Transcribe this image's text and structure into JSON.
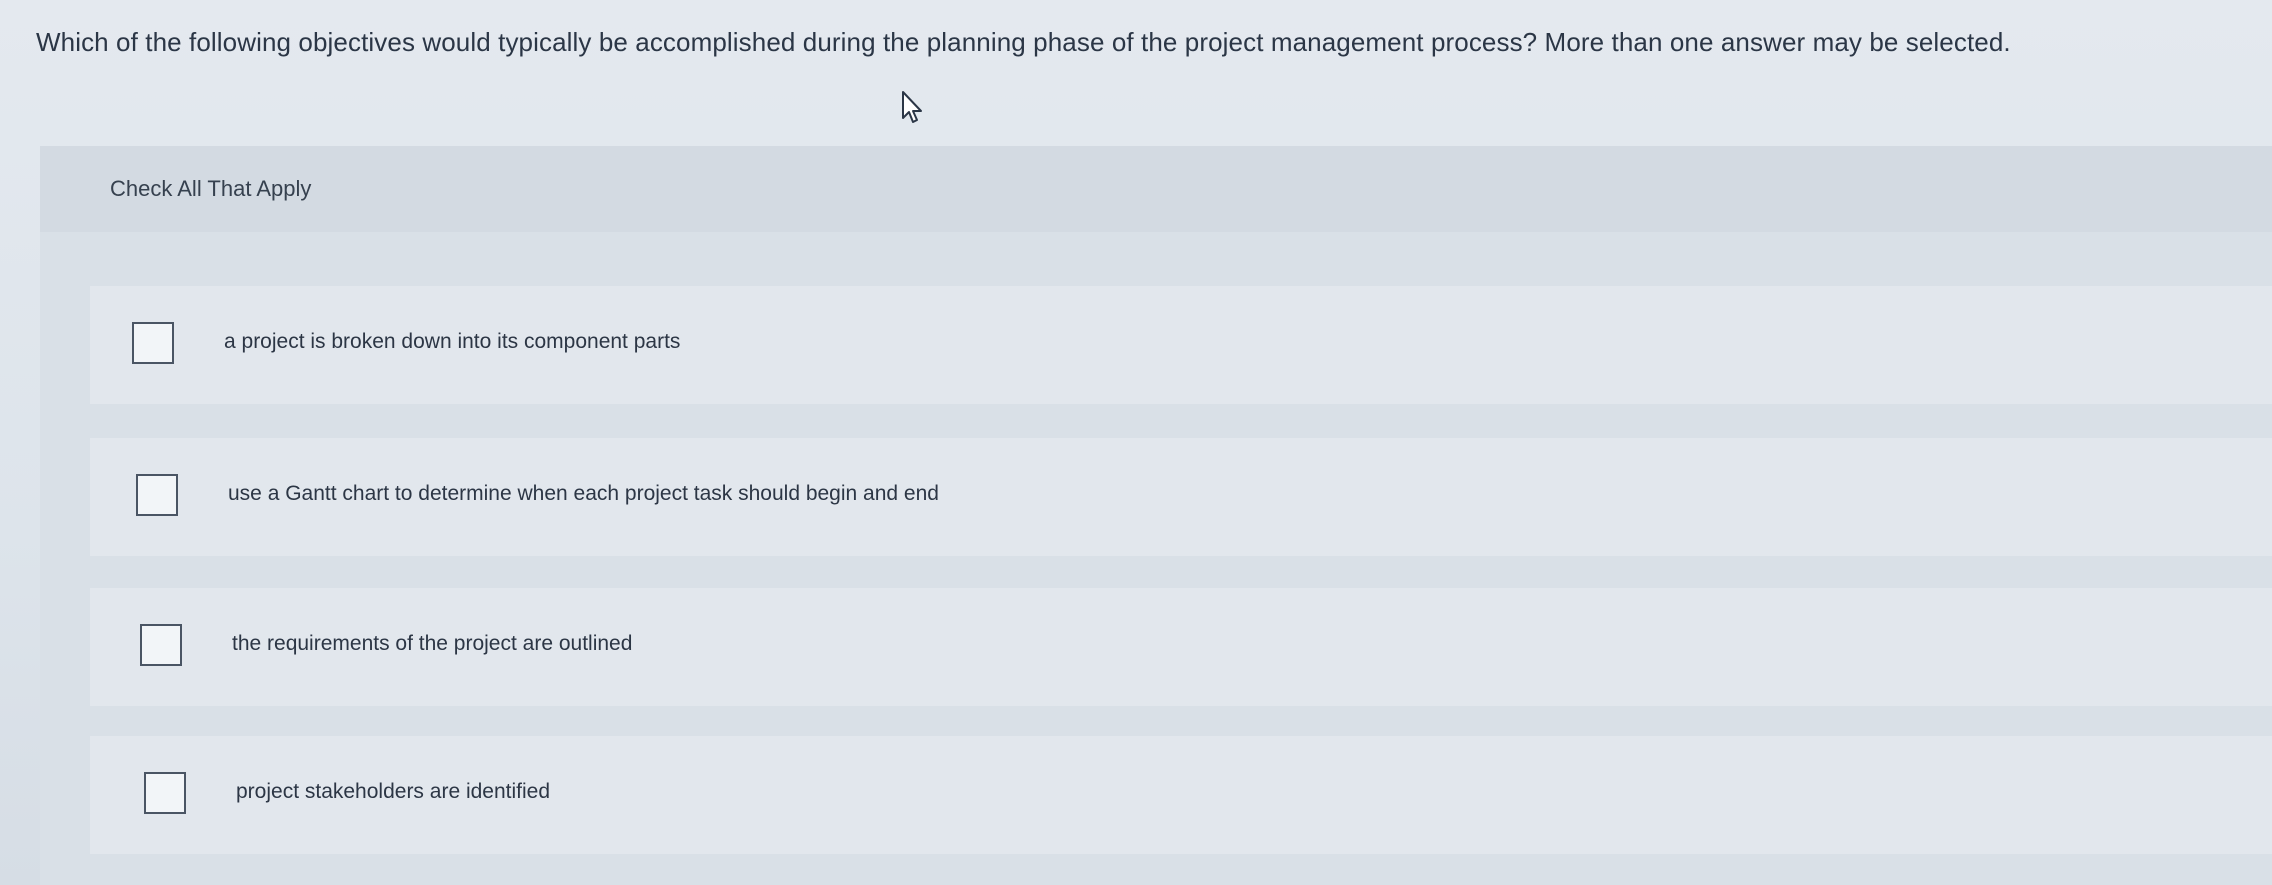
{
  "question": {
    "text": "Which of the following objectives would typically be accomplished during the planning phase of the project management process? More than one answer may be selected."
  },
  "panel": {
    "instruction": "Check All That Apply"
  },
  "options": [
    {
      "label": "a project is broken down into its component parts",
      "checked": false
    },
    {
      "label": "use a Gantt chart to determine when each project task should begin and end",
      "checked": false
    },
    {
      "label": "the requirements of the project are outlined",
      "checked": false
    },
    {
      "label": "project stakeholders are identified",
      "checked": false
    }
  ],
  "icons": {
    "cursor": "mouse-pointer-icon"
  }
}
